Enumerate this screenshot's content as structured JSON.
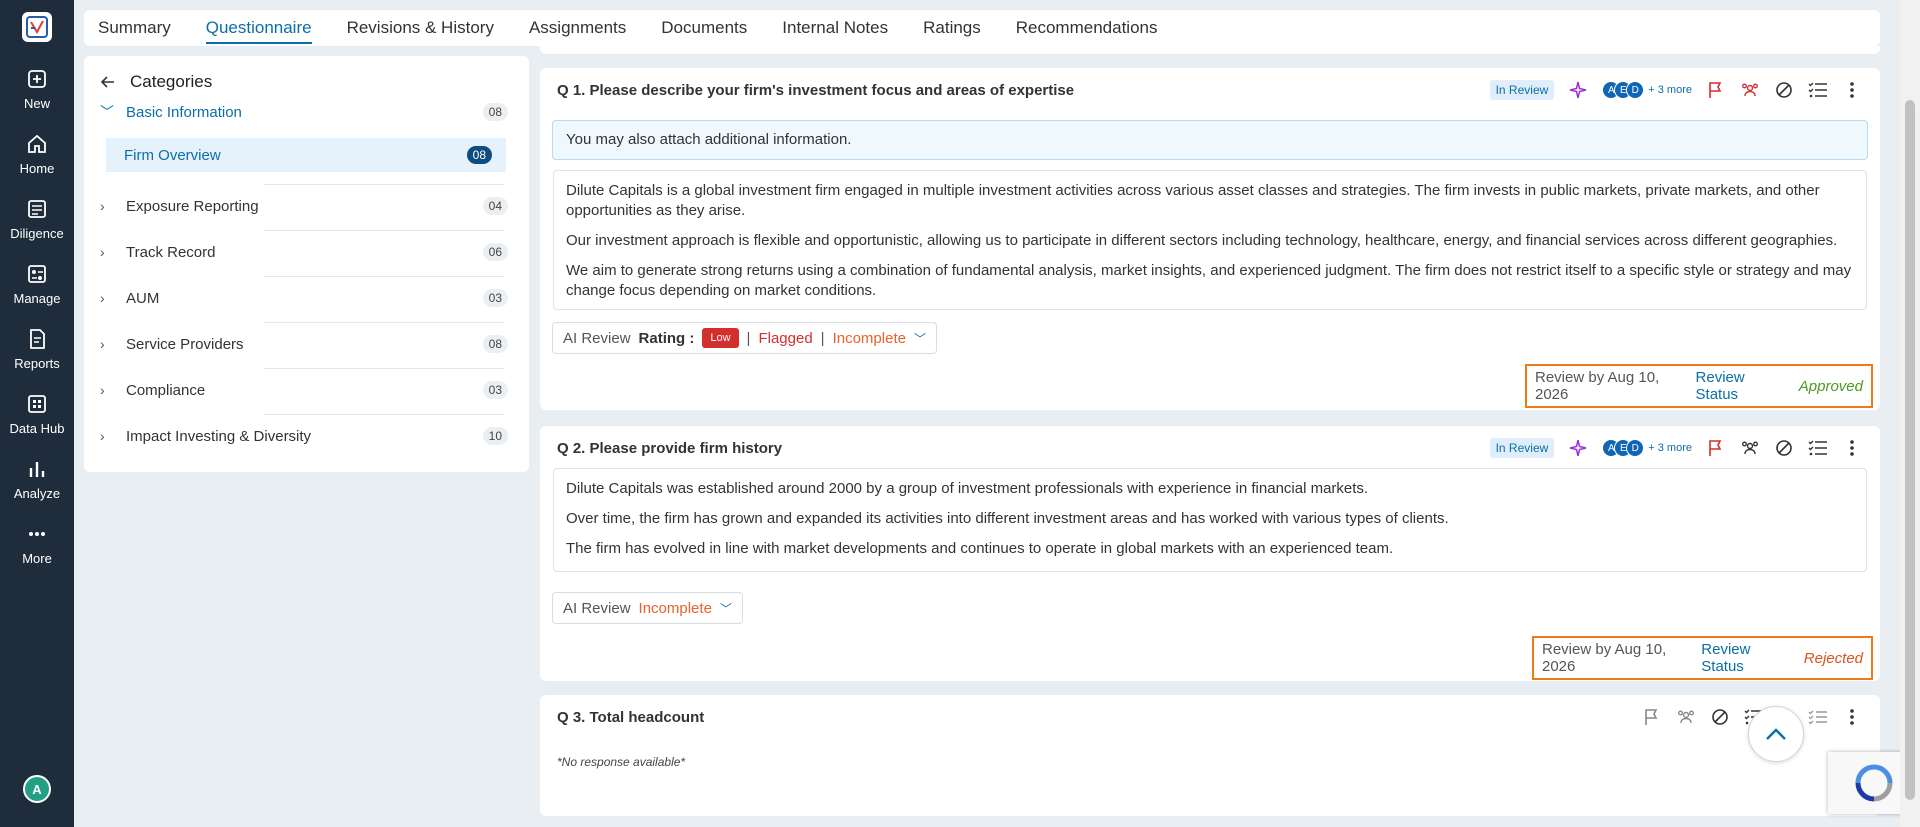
{
  "rail": {
    "items": [
      {
        "label": "New",
        "icon": "plus-square-icon"
      },
      {
        "label": "Home",
        "icon": "home-icon"
      },
      {
        "label": "Diligence",
        "icon": "diligence-icon"
      },
      {
        "label": "Manage",
        "icon": "manage-icon"
      },
      {
        "label": "Reports",
        "icon": "reports-icon"
      },
      {
        "label": "Data Hub",
        "icon": "data-hub-icon"
      },
      {
        "label": "Analyze",
        "icon": "bar-chart-icon"
      },
      {
        "label": "More",
        "icon": "ellipsis-icon"
      }
    ],
    "avatar_initial": "A"
  },
  "tabs": [
    "Summary",
    "Questionnaire",
    "Revisions & History",
    "Assignments",
    "Documents",
    "Internal Notes",
    "Ratings",
    "Recommendations"
  ],
  "active_tab": "Questionnaire",
  "categories": {
    "title": "Categories",
    "items": [
      {
        "label": "Basic Information",
        "count": "08",
        "open": true
      },
      {
        "label": "Exposure Reporting",
        "count": "04"
      },
      {
        "label": "Track Record",
        "count": "06"
      },
      {
        "label": "AUM",
        "count": "03"
      },
      {
        "label": "Service Providers",
        "count": "08"
      },
      {
        "label": "Compliance",
        "count": "03"
      },
      {
        "label": "Impact Investing & Diversity",
        "count": "10"
      }
    ],
    "sub_item": {
      "label": "Firm Overview",
      "count": "08"
    }
  },
  "q1": {
    "title": "Q 1. Please describe your firm's investment focus and areas of expertise",
    "status": "In Review",
    "avatars": [
      "A",
      "E",
      "D"
    ],
    "more": "+ 3 more",
    "info": "You may also attach additional information.",
    "answer": [
      "Dilute Capitals is a global investment firm engaged in multiple investment activities across various asset classes and strategies. The firm invests in public markets, private markets, and other opportunities as they arise.",
      "Our investment approach is flexible and opportunistic, allowing us to participate in different sectors including technology, healthcare, energy, and financial services across different geographies.",
      "We aim to generate strong returns using a combination of fundamental analysis, market insights, and experienced judgment. The firm does not restrict itself to a specific style or strategy and may change focus depending on market conditions."
    ],
    "ai_label": "AI Review",
    "rating_label": "Rating :",
    "rating": "Low",
    "flagged": "Flagged",
    "completeness": "Incomplete",
    "review_by": "Review by Aug 10, 2026",
    "review_status_label": "Review Status",
    "review_status": "Approved"
  },
  "q2": {
    "title": "Q 2. Please provide firm history",
    "status": "In Review",
    "avatars": [
      "A",
      "E",
      "D"
    ],
    "more": "+ 3 more",
    "answer": [
      "Dilute Capitals was established around 2000 by a group of investment professionals with experience in financial markets.",
      "Over time, the firm has grown and expanded its activities into different investment areas and has worked with various types of clients.",
      "The firm has evolved in line with market developments and continues to operate in global markets with an experienced team."
    ],
    "ai_label": "AI Review",
    "completeness": "Incomplete",
    "review_by": "Review by Aug 10, 2026",
    "review_status_label": "Review Status",
    "review_status": "Rejected"
  },
  "q3": {
    "title": "Q 3. Total headcount",
    "no_response": "*No response available*"
  },
  "separator": "|",
  "colors": {
    "accent": "#0b6ea8",
    "rail": "#1f2c3b",
    "highlight": "#f07a16",
    "danger": "#d32f2f"
  }
}
